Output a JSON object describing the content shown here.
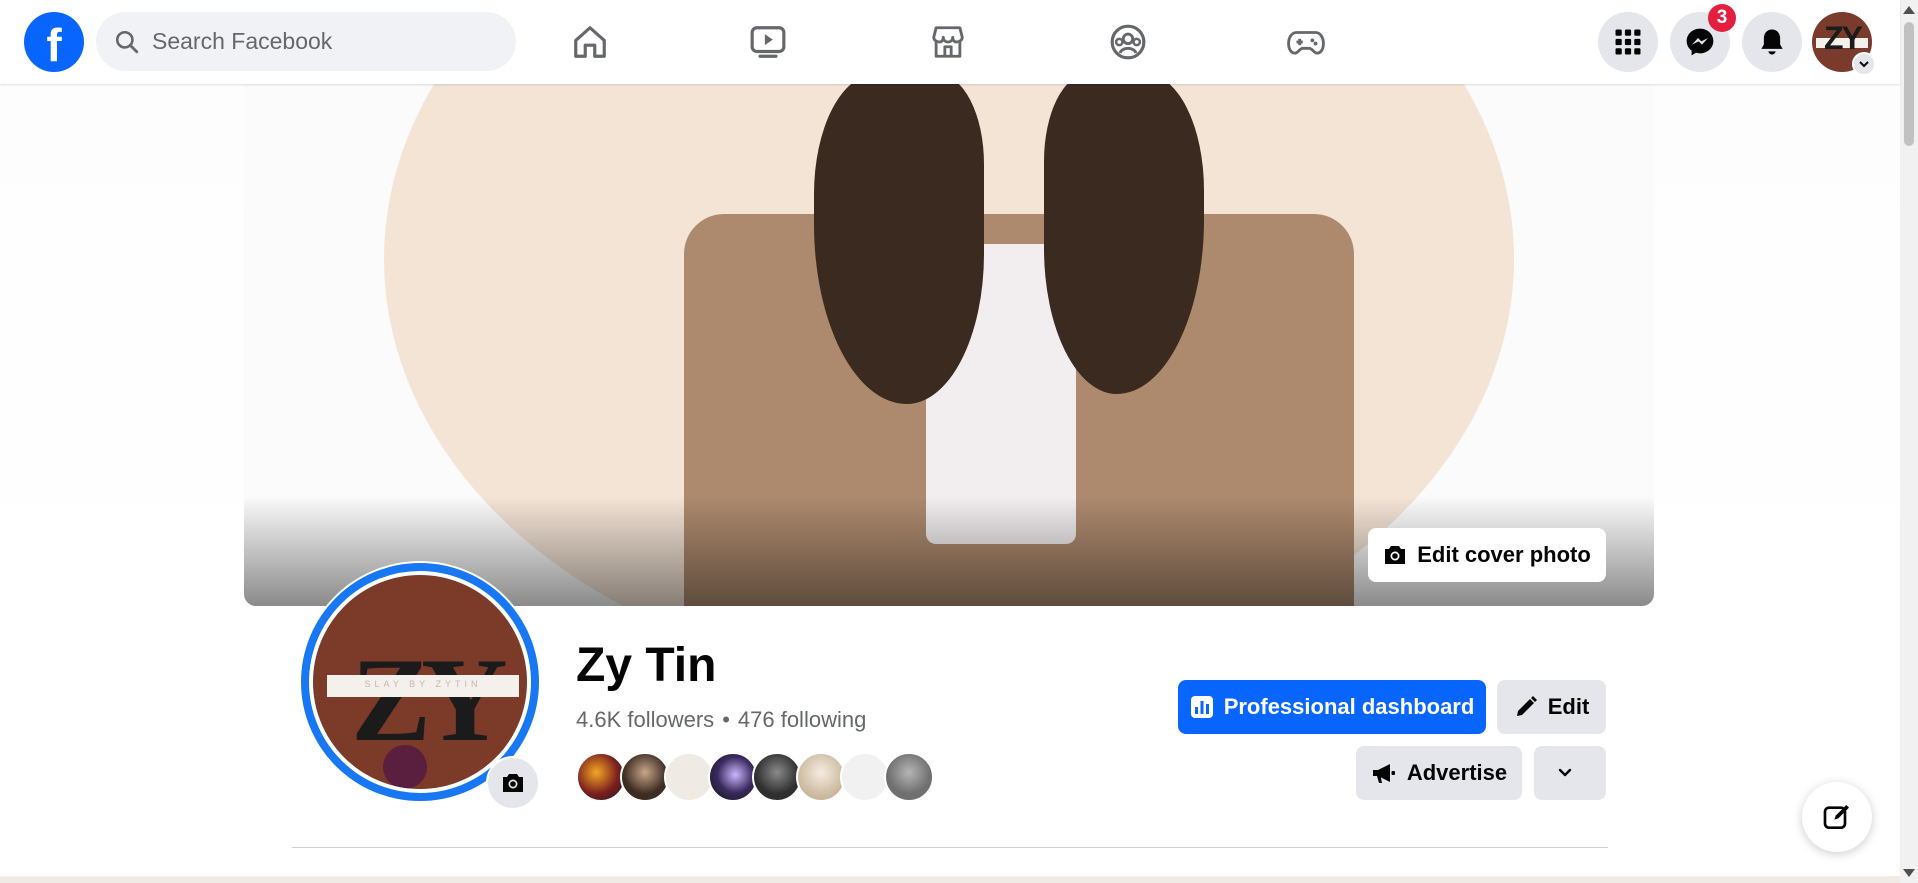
{
  "topbar": {
    "logo_letter": "f",
    "search_placeholder": "Search Facebook",
    "nav": [
      "home-icon",
      "video-icon",
      "marketplace-icon",
      "groups-icon",
      "gaming-icon"
    ],
    "messenger_badge": "3",
    "brand_color": "#0866ff"
  },
  "cover": {
    "edit_label": "Edit cover photo"
  },
  "profile": {
    "name": "Zy Tin",
    "followers": "4.6K followers",
    "separator": "•",
    "following": "476 following",
    "avatar_text": "ZY",
    "avatar_subtext": "SLAY BY ZYTIN"
  },
  "friends": [
    "#7a4a2a",
    "#6b5a4c",
    "#efeae4",
    "#3b2a5e",
    "#4a4a4a",
    "#e8dccd",
    "#f1f1f1",
    "#8a8a8a"
  ],
  "actions": {
    "dashboard_label": "Professional dashboard",
    "edit_label": "Edit",
    "advertise_label": "Advertise"
  }
}
